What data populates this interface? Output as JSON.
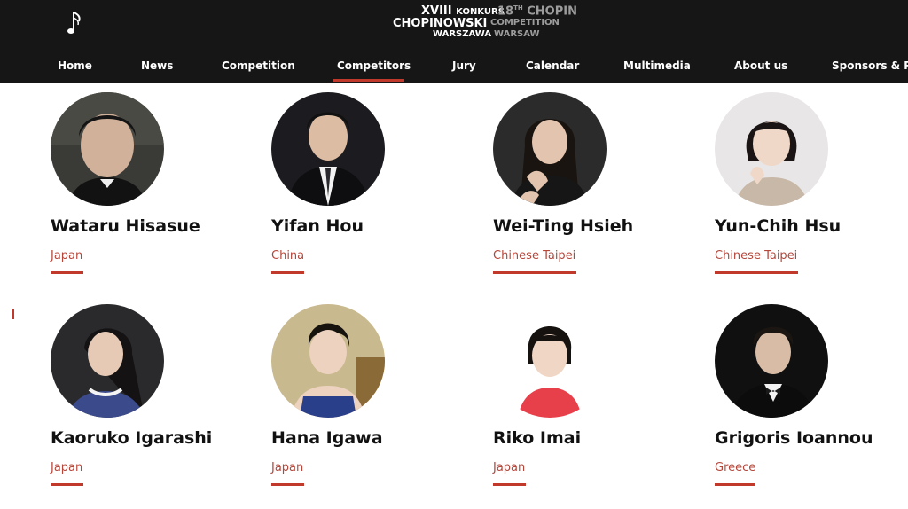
{
  "header": {
    "logo_konkurs_line1_num": "XVIII",
    "logo_konkurs_line1_word": "KONKURS",
    "logo_konkurs_line2": "CHOPINOWSKI",
    "logo_konkurs_line3": "WARSZAWA",
    "logo_competition_line1_num": "18",
    "logo_competition_line1_sup": "TH",
    "logo_competition_line1_word": "CHOPIN",
    "logo_competition_line2": "COMPETITION",
    "logo_competition_line3": "WARSAW",
    "logo_icon": "music-note-icon"
  },
  "nav": {
    "items": [
      {
        "label": "Home"
      },
      {
        "label": "News"
      },
      {
        "label": "Competition"
      },
      {
        "label": "Competitors",
        "active": true
      },
      {
        "label": "Jury"
      },
      {
        "label": "Calendar"
      },
      {
        "label": "Multimedia"
      },
      {
        "label": "About us"
      },
      {
        "label": "Sponsors & Par"
      }
    ],
    "active_color": "#c0392b"
  },
  "competitors": [
    {
      "name": "Wataru Hisasue",
      "country": "Japan"
    },
    {
      "name": "Yifan Hou",
      "country": "China"
    },
    {
      "name": "Wei-Ting Hsieh",
      "country": "Chinese Taipei"
    },
    {
      "name": "Yun-Chih Hsu",
      "country": "Chinese Taipei"
    },
    {
      "name": "Kaoruko Igarashi",
      "country": "Japan"
    },
    {
      "name": "Hana Igawa",
      "country": "Japan"
    },
    {
      "name": "Riko Imai",
      "country": "Japan"
    },
    {
      "name": "Grigoris Ioannou",
      "country": "Greece"
    }
  ],
  "colors": {
    "header_bg": "#161616",
    "accent": "#c0392b",
    "country_text": "#b5463a"
  }
}
